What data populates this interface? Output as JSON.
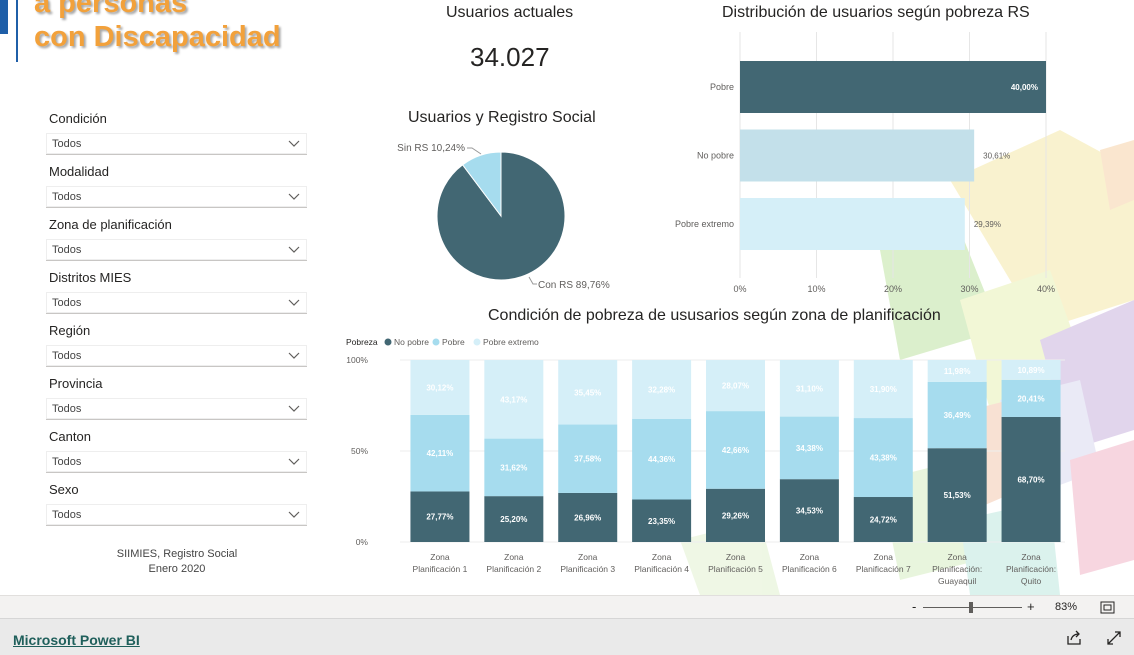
{
  "logo": {
    "line1": "a personas",
    "line2": "con Discapacidad"
  },
  "filters": [
    {
      "label": "Condición",
      "value": "Todos"
    },
    {
      "label": "Modalidad",
      "value": "Todos"
    },
    {
      "label": "Zona de planificación",
      "value": "Todos"
    },
    {
      "label": "Distritos MIES",
      "value": "Todos"
    },
    {
      "label": "Región",
      "value": "Todos"
    },
    {
      "label": "Provincia",
      "value": "Todos"
    },
    {
      "label": "Canton",
      "value": "Todos"
    },
    {
      "label": "Sexo",
      "value": "Todos"
    }
  ],
  "source": {
    "line1": "SIIMIES, Registro Social",
    "line2": "Enero 2020"
  },
  "kpi": {
    "title": "Usuarios actuales",
    "value": "34.027"
  },
  "colors": {
    "no_pobre": "#426773",
    "pobre": "#a6dcee",
    "pobre_extremo": "#d5eff8",
    "hbar_pobre": "#426773",
    "hbar_no_pobre": "#c3e0ea",
    "hbar_pobre_extremo": "#d5eff8"
  },
  "charts": {
    "pie_title": "Usuarios y Registro Social",
    "hbar_title": "Distribución de usuarios según pobreza RS",
    "stack_title": "Condición de pobreza de ususarios según zona de planificación"
  },
  "chart_data": [
    {
      "type": "pie",
      "title": "Usuarios y Registro Social",
      "labels": [
        "Con RS",
        "Sin RS"
      ],
      "values": [
        89.76,
        10.24
      ],
      "value_labels": [
        "Con RS 89,76%",
        "Sin RS 10,24%"
      ]
    },
    {
      "type": "bar",
      "orientation": "horizontal",
      "title": "Distribución de usuarios según pobreza RS",
      "categories": [
        "Pobre",
        "No pobre",
        "Pobre extremo"
      ],
      "values": [
        40.0,
        30.61,
        29.39
      ],
      "value_labels": [
        "40,00%",
        "30,61%",
        "29,39%"
      ],
      "xticks": [
        "0%",
        "10%",
        "20%",
        "30%",
        "40%"
      ],
      "xlim": [
        0,
        40
      ]
    },
    {
      "type": "bar",
      "stacked": true,
      "title": "Condición de pobreza de ususarios según zona de planificación",
      "legend_title": "Pobreza",
      "categories": [
        [
          "Zona",
          "Planificación 1"
        ],
        [
          "Zona",
          "Planificación 2"
        ],
        [
          "Zona",
          "Planificación 3"
        ],
        [
          "Zona",
          "Planificación 4"
        ],
        [
          "Zona",
          "Planificación 5"
        ],
        [
          "Zona",
          "Planificación 6"
        ],
        [
          "Zona",
          "Planificación 7"
        ],
        [
          "Zona",
          "Planificación:",
          "Guayaquil"
        ],
        [
          "Zona",
          "Planificación:",
          "Quito"
        ]
      ],
      "series": [
        {
          "name": "No pobre",
          "values": [
            27.77,
            25.2,
            26.96,
            23.35,
            29.26,
            34.53,
            24.72,
            51.53,
            68.7
          ],
          "labels": [
            "27,77%",
            "25,20%",
            "26,96%",
            "23,35%",
            "29,26%",
            "34,53%",
            "24,72%",
            "51,53%",
            "68,70%"
          ]
        },
        {
          "name": "Pobre",
          "values": [
            42.11,
            31.62,
            37.58,
            44.36,
            42.66,
            34.38,
            43.38,
            36.49,
            20.41
          ],
          "labels": [
            "42,11%",
            "31,62%",
            "37,58%",
            "44,36%",
            "42,66%",
            "34,38%",
            "43,38%",
            "36,49%",
            "20,41%"
          ]
        },
        {
          "name": "Pobre extremo",
          "values": [
            30.12,
            43.17,
            35.45,
            32.28,
            28.07,
            31.1,
            31.9,
            11.98,
            10.89
          ],
          "labels": [
            "30,12%",
            "43,17%",
            "35,45%",
            "32,28%",
            "28,07%",
            "31,10%",
            "31,90%",
            "11,98%",
            "10,89%"
          ]
        }
      ],
      "yticks": [
        "0%",
        "50%",
        "100%"
      ],
      "ylim": [
        0,
        100
      ],
      "legend_position": "top-left"
    }
  ],
  "zoom": {
    "minus": "-",
    "plus": "+",
    "level": "83%",
    "fraction": 0.48
  },
  "footer": {
    "brand": "Microsoft Power BI"
  }
}
